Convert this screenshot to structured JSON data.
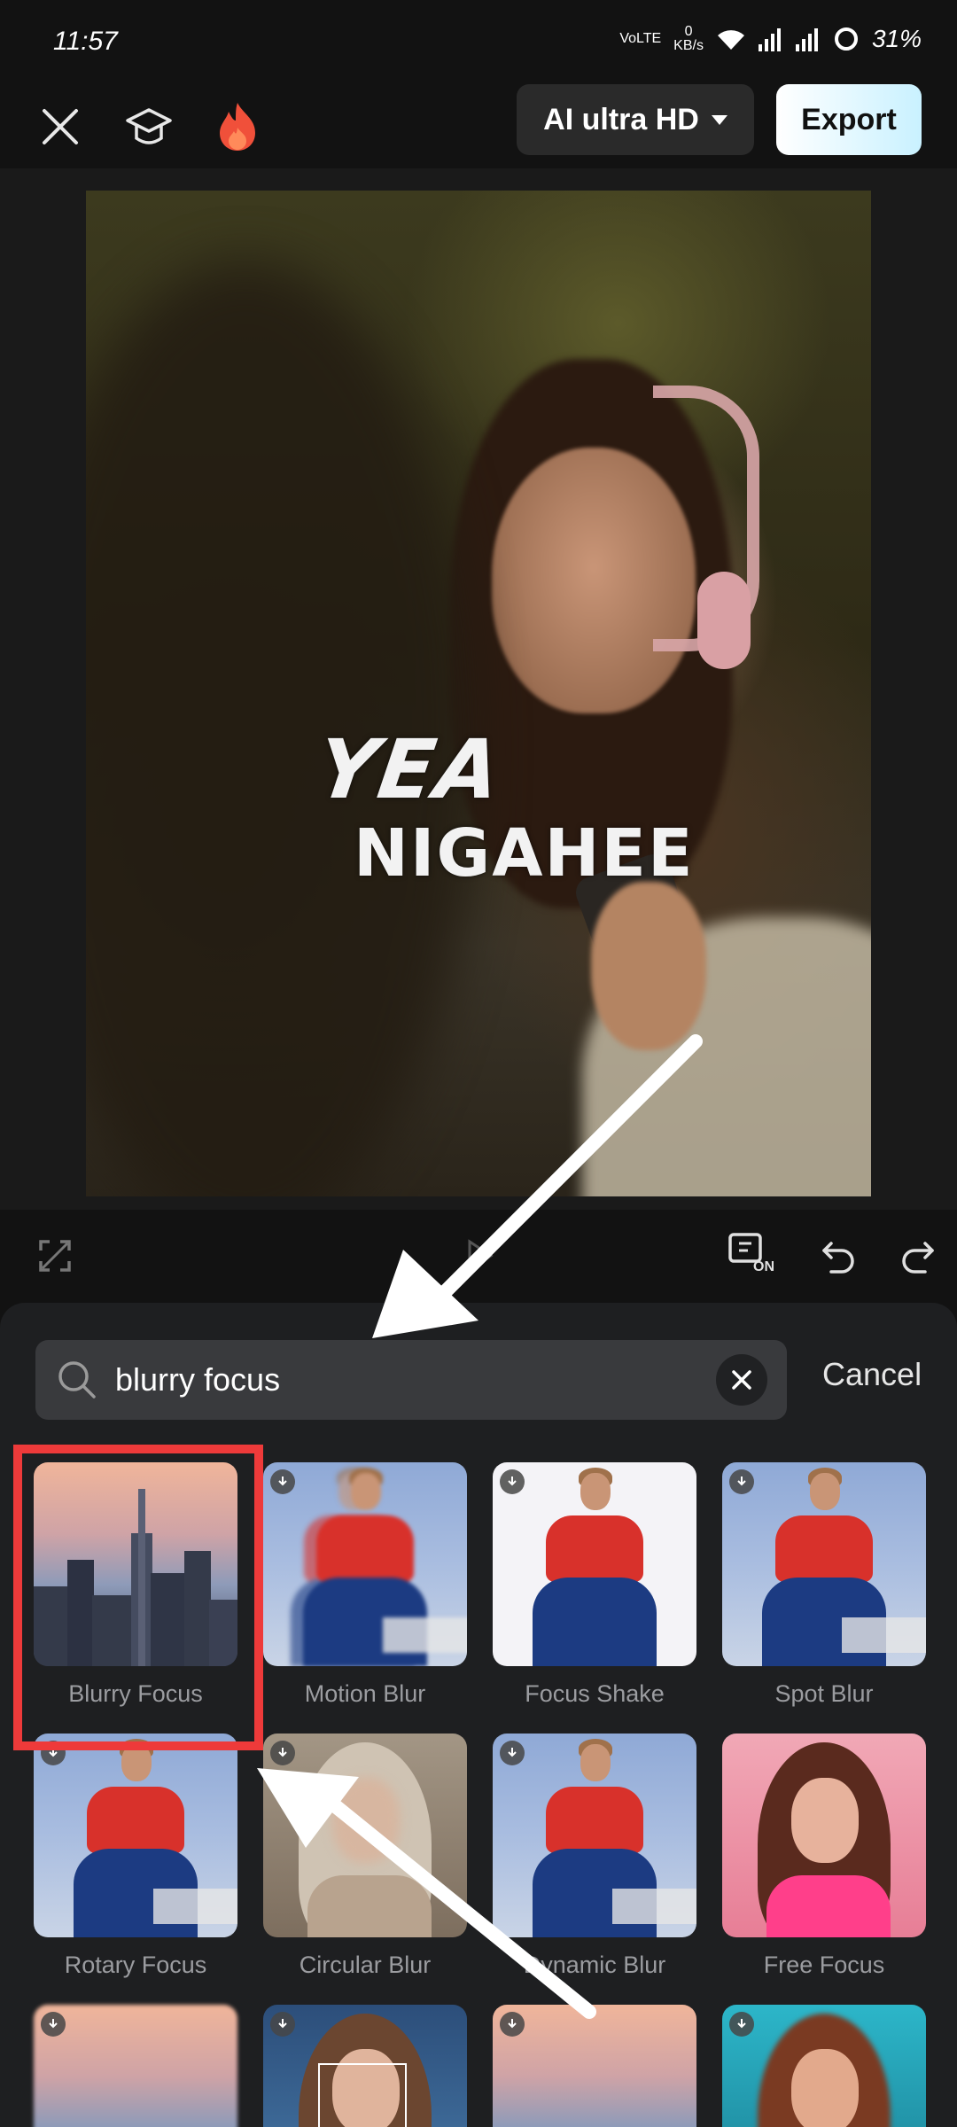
{
  "status_bar": {
    "time": "11:57",
    "network": "VoLTE",
    "data_rate_value": "0",
    "data_rate_unit": "KB/s",
    "battery": "31%"
  },
  "top_bar": {
    "quality_label": "AI ultra HD",
    "export_label": "Export",
    "icons": [
      "close-icon",
      "graduation-cap-icon",
      "flame-icon"
    ]
  },
  "video": {
    "overlay_line_1": "YEA",
    "overlay_line_2": "NIGAHEE"
  },
  "controls": {
    "icons": [
      "fullscreen-icon",
      "play-icon",
      "preview-on-icon",
      "undo-icon",
      "redo-icon"
    ],
    "preview_badge": "ON"
  },
  "search": {
    "value": "blurry focus",
    "cancel_label": "Cancel"
  },
  "effects": [
    {
      "label": "Blurry Focus",
      "downloadable": false,
      "selected": true
    },
    {
      "label": "Motion Blur",
      "downloadable": true
    },
    {
      "label": "Focus Shake",
      "downloadable": true
    },
    {
      "label": "Spot Blur",
      "downloadable": true
    },
    {
      "label": "Rotary Focus",
      "downloadable": true
    },
    {
      "label": "Circular Blur",
      "downloadable": true
    },
    {
      "label": "Dynamic Blur",
      "downloadable": true
    },
    {
      "label": "Free Focus",
      "downloadable": false
    },
    {
      "label": "",
      "downloadable": true
    },
    {
      "label": "",
      "downloadable": true
    },
    {
      "label": "",
      "downloadable": true
    },
    {
      "label": "",
      "downloadable": true
    }
  ],
  "colors": {
    "accent_highlight": "#ee3a3a",
    "panel_bg": "#1e1f21",
    "export_gradient_end": "#c9f1ff"
  }
}
